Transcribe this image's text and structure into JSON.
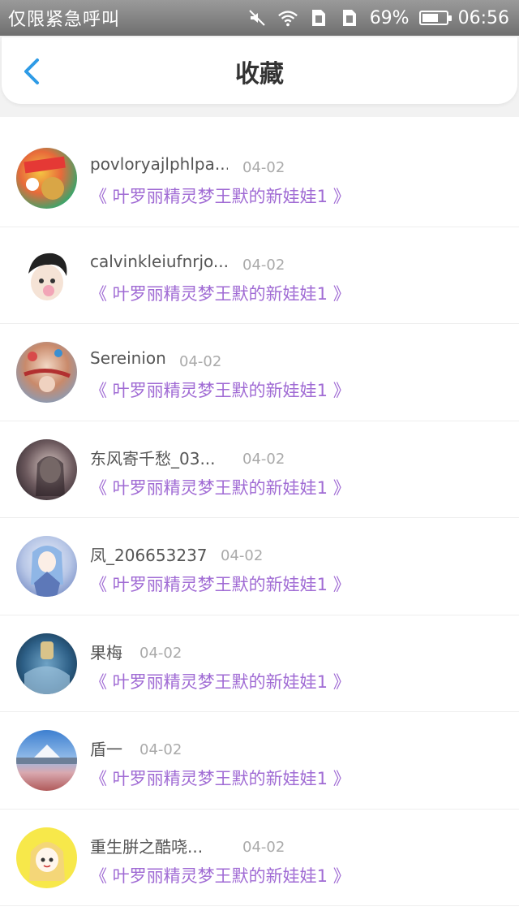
{
  "status_bar": {
    "left_text": "仅限紧急呼叫",
    "battery_percent": "69%",
    "battery_level": 0.69,
    "time": "06:56",
    "icons": [
      "mute-icon",
      "wifi-icon",
      "sim-1-icon",
      "sim-2-icon",
      "battery-icon"
    ]
  },
  "header": {
    "title": "收藏",
    "back_icon": "chevron-left-icon",
    "accent_color": "#2e9be6"
  },
  "list": {
    "link_color": "#a06bd4",
    "items": [
      {
        "name": "povloryajlphlpa...",
        "date": "04-02",
        "book": "《 叶罗丽精灵梦王默的新娃娃1 》"
      },
      {
        "name": "calvinkleiufnrjo...",
        "date": "04-02",
        "book": "《 叶罗丽精灵梦王默的新娃娃1 》"
      },
      {
        "name": "Sereinion",
        "date": "04-02",
        "book": "《 叶罗丽精灵梦王默的新娃娃1 》"
      },
      {
        "name": "东风寄千愁_03...",
        "date": "04-02",
        "book": "《 叶罗丽精灵梦王默的新娃娃1 》"
      },
      {
        "name": "凤_206653237",
        "date": "04-02",
        "book": "《 叶罗丽精灵梦王默的新娃娃1 》"
      },
      {
        "name": "果梅",
        "date": "04-02",
        "book": "《 叶罗丽精灵梦王默的新娃娃1 》"
      },
      {
        "name": "盾一",
        "date": "04-02",
        "book": "《 叶罗丽精灵梦王默的新娃娃1 》"
      },
      {
        "name": "重生腁之酷哓...",
        "date": "04-02",
        "book": "《 叶罗丽精灵梦王默的新娃娃1 》"
      }
    ]
  }
}
